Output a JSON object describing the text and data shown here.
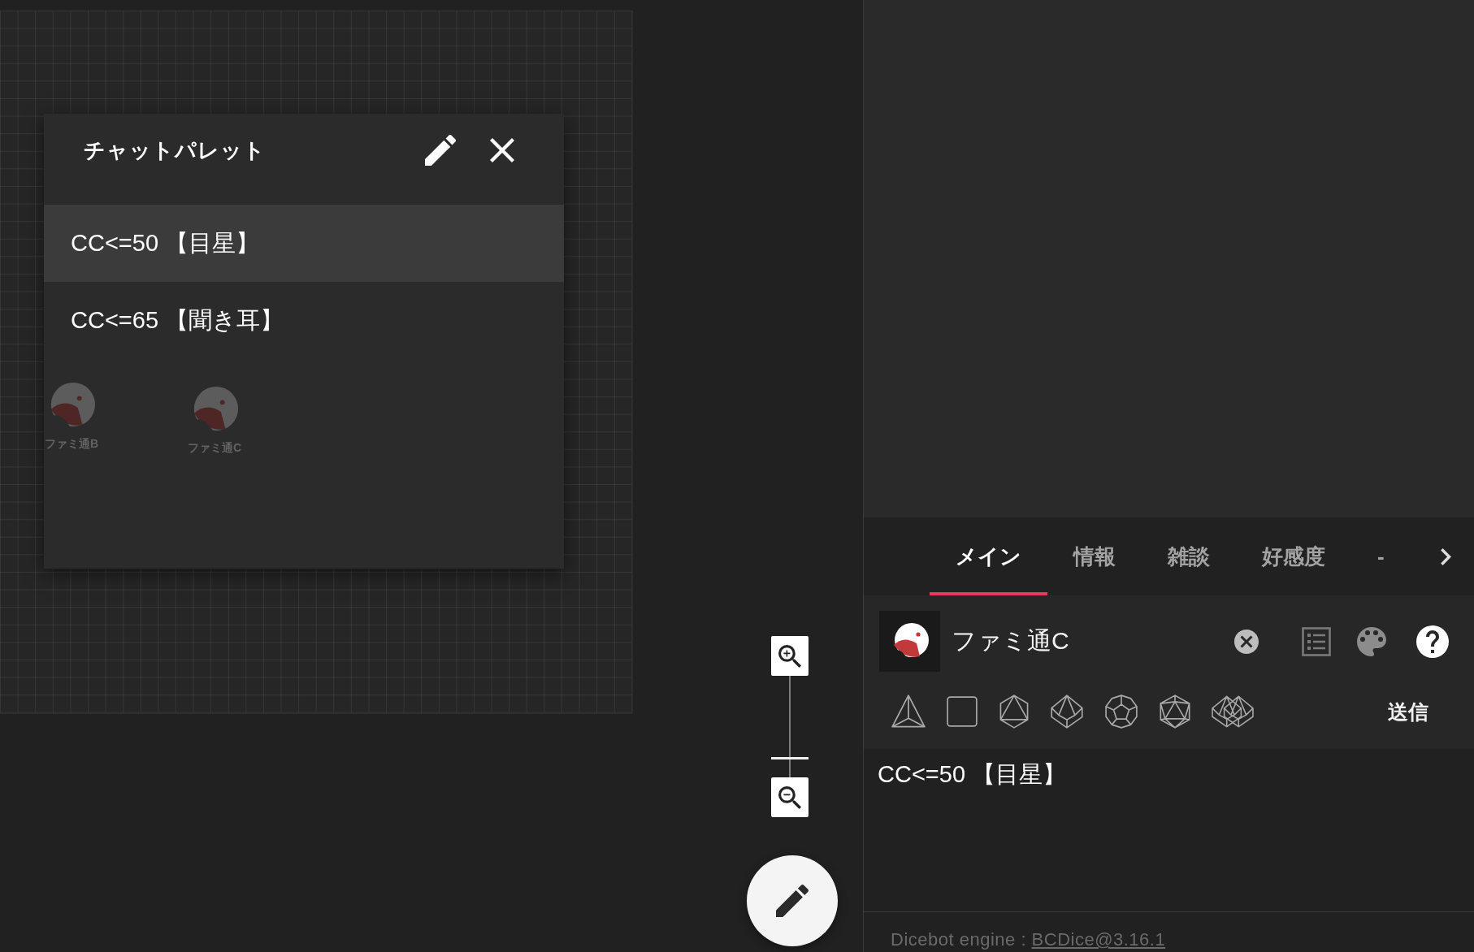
{
  "board": {
    "tokens": [
      {
        "label": "ファミ通B"
      },
      {
        "label": "ファミ通C"
      }
    ]
  },
  "chat_palette": {
    "title": "チャットパレット",
    "items": [
      {
        "text": "CC<=50 【目星】",
        "selected": true
      },
      {
        "text": "CC<=65 【聞き耳】",
        "selected": false
      }
    ]
  },
  "zoom": {
    "level": 0.18
  },
  "chat": {
    "tabs": [
      {
        "label": "メイン",
        "selected": true
      },
      {
        "label": "情報",
        "selected": false
      },
      {
        "label": "雑談",
        "selected": false
      },
      {
        "label": "好感度",
        "selected": false
      },
      {
        "label": "-",
        "selected": false
      }
    ],
    "character": {
      "name": "ファミ通C"
    },
    "dice": [
      {
        "kind": "d4"
      },
      {
        "kind": "d6"
      },
      {
        "kind": "d8"
      },
      {
        "kind": "d10"
      },
      {
        "kind": "d12"
      },
      {
        "kind": "d20"
      },
      {
        "kind": "d100"
      }
    ],
    "send_button": "送信",
    "message": {
      "value": "CC<=50 【目星】"
    },
    "footer": {
      "text": "Dicebot engine : ",
      "link": "BCDice@3.16.1"
    }
  }
}
